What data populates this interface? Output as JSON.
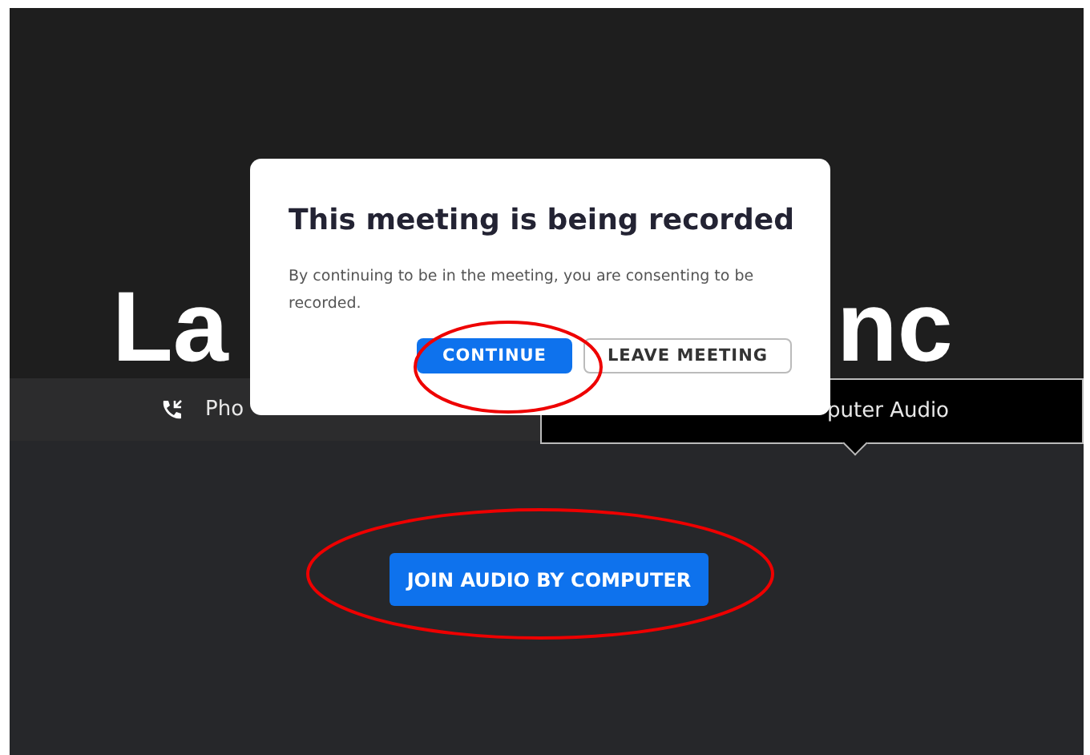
{
  "meeting_title_fragments": [
    {
      "text": "La"
    },
    {
      "text": "nc"
    }
  ],
  "audio_tabs": [
    {
      "label": "Pho",
      "selected": false,
      "kind": "phone"
    },
    {
      "label": "puter Audio",
      "selected": true,
      "kind": "computer"
    }
  ],
  "join_button": {
    "label": "JOIN AUDIO BY COMPUTER"
  },
  "dialog": {
    "title": "This meeting is being recorded",
    "message": "By continuing to be in the meeting, you are consenting to be recorded.",
    "buttons": [
      {
        "label": "CONTINUE",
        "kind": "primary"
      },
      {
        "label": "LEAVE MEETING",
        "kind": "secondary"
      }
    ]
  }
}
